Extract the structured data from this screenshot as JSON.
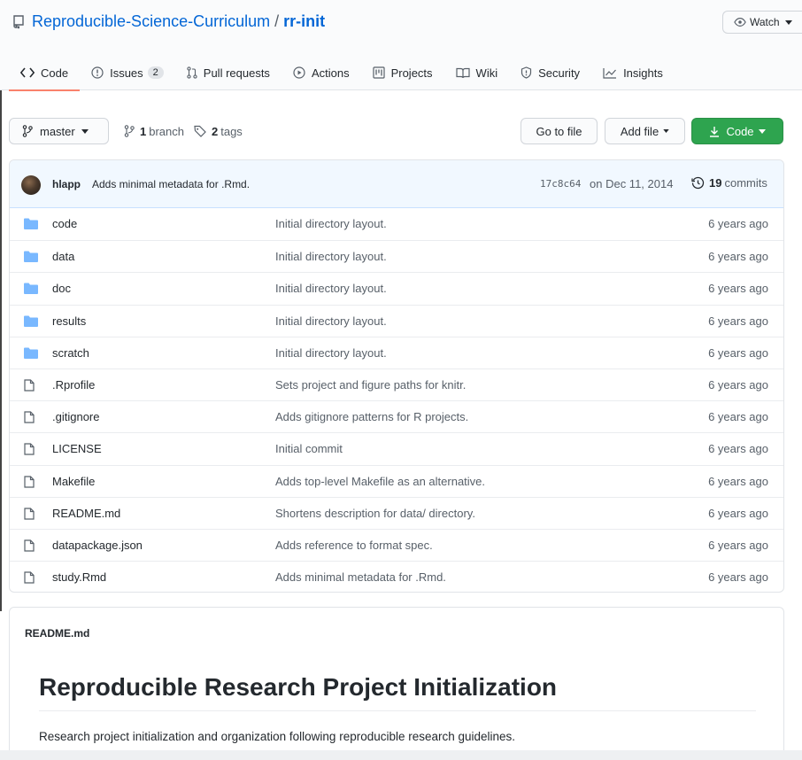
{
  "repo": {
    "owner": "Reproducible-Science-Curriculum",
    "separator": "/",
    "name": "rr-init",
    "watch_label": "Watch"
  },
  "tabs": [
    {
      "label": "Code",
      "icon": "code-icon"
    },
    {
      "label": "Issues",
      "icon": "issue-icon",
      "count": "2"
    },
    {
      "label": "Pull requests",
      "icon": "pull-request-icon"
    },
    {
      "label": "Actions",
      "icon": "play-icon"
    },
    {
      "label": "Projects",
      "icon": "project-icon"
    },
    {
      "label": "Wiki",
      "icon": "book-icon"
    },
    {
      "label": "Security",
      "icon": "shield-icon"
    },
    {
      "label": "Insights",
      "icon": "graph-icon"
    }
  ],
  "toolbar": {
    "branch": "master",
    "branch_count": "1",
    "branch_label": "branch",
    "tag_count": "2",
    "tag_label": "tags",
    "go_to_file": "Go to file",
    "add_file": "Add file",
    "code": "Code"
  },
  "latest_commit": {
    "author": "hlapp",
    "message": "Adds minimal metadata for .Rmd.",
    "sha": "17c8c64",
    "date": "on Dec 11, 2014",
    "commit_count": "19",
    "commit_label": "commits"
  },
  "files": [
    {
      "name": "code",
      "type": "dir",
      "message": "Initial directory layout.",
      "age": "6 years ago"
    },
    {
      "name": "data",
      "type": "dir",
      "message": "Initial directory layout.",
      "age": "6 years ago"
    },
    {
      "name": "doc",
      "type": "dir",
      "message": "Initial directory layout.",
      "age": "6 years ago"
    },
    {
      "name": "results",
      "type": "dir",
      "message": "Initial directory layout.",
      "age": "6 years ago"
    },
    {
      "name": "scratch",
      "type": "dir",
      "message": "Initial directory layout.",
      "age": "6 years ago"
    },
    {
      "name": ".Rprofile",
      "type": "file",
      "message": "Sets project and figure paths for knitr.",
      "age": "6 years ago"
    },
    {
      "name": ".gitignore",
      "type": "file",
      "message": "Adds gitignore patterns for R projects.",
      "age": "6 years ago"
    },
    {
      "name": "LICENSE",
      "type": "file",
      "message": "Initial commit",
      "age": "6 years ago"
    },
    {
      "name": "Makefile",
      "type": "file",
      "message": "Adds top-level Makefile as an alternative.",
      "age": "6 years ago"
    },
    {
      "name": "README.md",
      "type": "file",
      "message": "Shortens description for data/ directory.",
      "age": "6 years ago"
    },
    {
      "name": "datapackage.json",
      "type": "file",
      "message": "Adds reference to format spec.",
      "age": "6 years ago"
    },
    {
      "name": "study.Rmd",
      "type": "file",
      "message": "Adds minimal metadata for .Rmd.",
      "age": "6 years ago"
    }
  ],
  "readme": {
    "label": "README.md",
    "title": "Reproducible Research Project Initialization",
    "paragraph": "Research project initialization and organization following reproducible research guidelines."
  },
  "colors": {
    "link": "#0366d6",
    "folder": "#79b8ff",
    "primary_button": "#2ea44f",
    "active_tab_underline": "#f9826c",
    "commit_bar": "#f1f8ff"
  }
}
